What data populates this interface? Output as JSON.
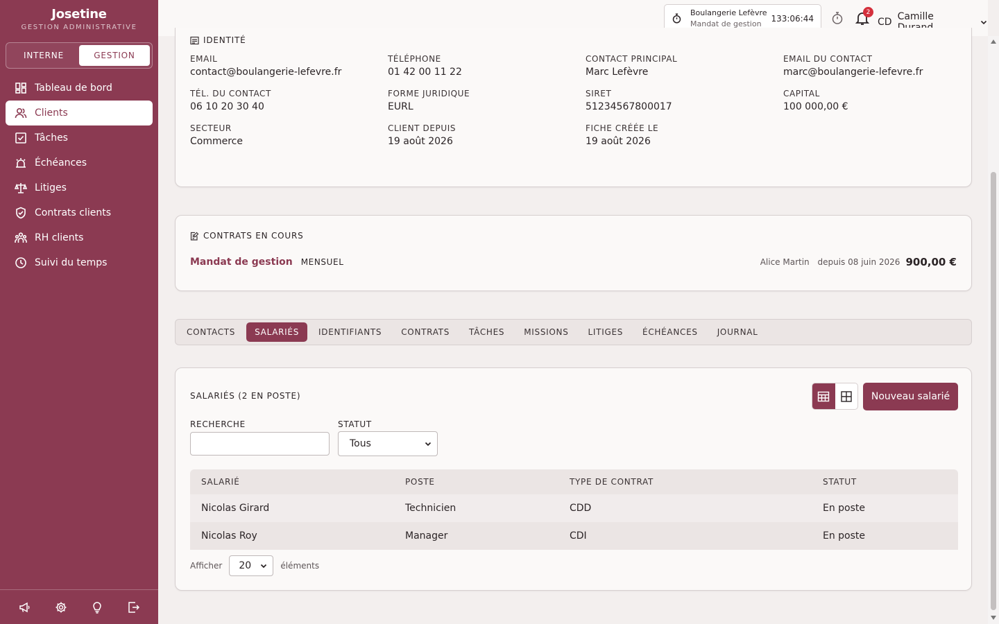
{
  "app": {
    "name": "Josetine",
    "subtitle": "GESTION ADMINISTRATIVE"
  },
  "mode_switch": {
    "left": "INTERNE",
    "right": "GESTION",
    "selected": "GESTION"
  },
  "sidebar": {
    "items": [
      {
        "label": "Tableau de bord",
        "icon": "dashboard-icon"
      },
      {
        "label": "Clients",
        "icon": "users-icon",
        "active": true
      },
      {
        "label": "Tâches",
        "icon": "checkbox-icon"
      },
      {
        "label": "Échéances",
        "icon": "alarm-icon"
      },
      {
        "label": "Litiges",
        "icon": "scale-icon"
      },
      {
        "label": "Contrats clients",
        "icon": "shield-check-icon"
      },
      {
        "label": "RH clients",
        "icon": "people-group-icon"
      },
      {
        "label": "Suivi du temps",
        "icon": "clock-icon"
      }
    ],
    "footer_icons": [
      "megaphone-icon",
      "gear-icon",
      "lightbulb-icon",
      "logout-icon"
    ]
  },
  "topbar": {
    "timer": {
      "client": "Boulangerie Lefèvre",
      "task": "Mandat de gestion",
      "elapsed": "133:06:44"
    },
    "notifications_count": "2",
    "user": {
      "initials": "CD",
      "name": "Camille Durand"
    }
  },
  "identity": {
    "title": "IDENTITÉ",
    "fields": [
      {
        "label": "EMAIL",
        "value": "contact@boulangerie-lefevre.fr"
      },
      {
        "label": "TÉLÉPHONE",
        "value": "01 42 00 11 22"
      },
      {
        "label": "CONTACT PRINCIPAL",
        "value": "Marc Lefèvre"
      },
      {
        "label": "EMAIL DU CONTACT",
        "value": "marc@boulangerie-lefevre.fr"
      },
      {
        "label": "TÉL. DU CONTACT",
        "value": "06 10 20 30 40"
      },
      {
        "label": "FORME JURIDIQUE",
        "value": "EURL"
      },
      {
        "label": "SIRET",
        "value": "51234567800017"
      },
      {
        "label": "CAPITAL",
        "value": "100 000,00 €"
      },
      {
        "label": "SECTEUR",
        "value": "Commerce"
      },
      {
        "label": "CLIENT DEPUIS",
        "value": "19 août 2026"
      },
      {
        "label": "FICHE CRÉÉE LE",
        "value": "19 août 2026"
      }
    ]
  },
  "contracts": {
    "title": "CONTRATS EN COURS",
    "items": [
      {
        "name": "Mandat de gestion",
        "frequency": "MENSUEL",
        "owner": "Alice Martin",
        "since": "depuis 08 juin 2026",
        "amount": "900,00 €"
      }
    ]
  },
  "tabs": [
    "CONTACTS",
    "SALARIÉS",
    "IDENTIFIANTS",
    "CONTRATS",
    "TÂCHES",
    "MISSIONS",
    "LITIGES",
    "ÉCHÉANCES",
    "JOURNAL"
  ],
  "active_tab": "SALARIÉS",
  "employees": {
    "title": "SALARIÉS (2 EN POSTE)",
    "new_button": "Nouveau salarié",
    "search_label": "RECHERCHE",
    "search_value": "",
    "status_label": "STATUT",
    "status_value": "Tous",
    "columns": [
      "SALARIÉ",
      "POSTE",
      "TYPE DE CONTRAT",
      "STATUT"
    ],
    "rows": [
      {
        "name": "Nicolas Girard",
        "role": "Technicien",
        "contract": "CDD",
        "status": "En poste"
      },
      {
        "name": "Nicolas Roy",
        "role": "Manager",
        "contract": "CDI",
        "status": "En poste"
      }
    ],
    "pager": {
      "before": "Afficher",
      "value": "20",
      "after": "éléments"
    }
  },
  "colors": {
    "brand": "#8b3a52",
    "background": "#f3efee",
    "badge": "#d4303c"
  }
}
